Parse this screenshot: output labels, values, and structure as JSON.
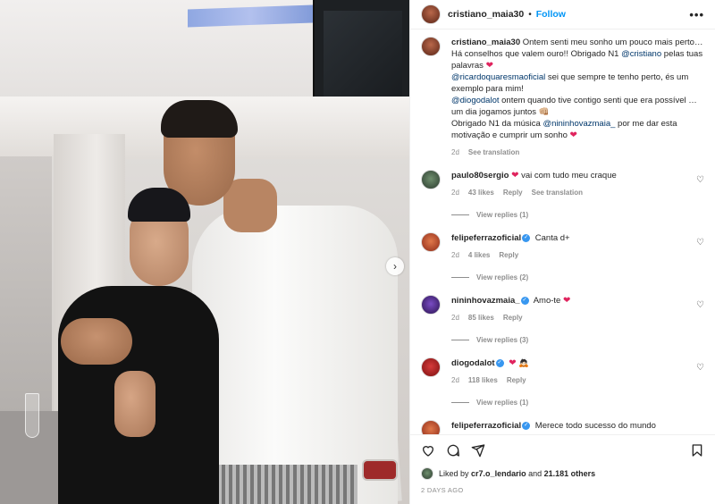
{
  "post": {
    "username": "cristiano_maia30",
    "follow_label": "Follow",
    "dot": "•",
    "more_label": "•••",
    "caption": {
      "username": "cristiano_maia30",
      "line1": "Ontem senti meu sonho um pouco mais perto…",
      "line2": "Há conselhos que valem ouro!! Obrigado N1",
      "mention1": "@cristiano",
      "line2b": "pelas tuas palavras",
      "mention2": "@ricardoquaresmaoficial",
      "line3": "sei que sempre te tenho perto, és um exemplo para mim!",
      "mention3": "@diogodalot",
      "line4": "ontem quando tive contigo senti que era possível … um dia jogamos juntos 👊🏼",
      "line5": "Obrigado N1 da música",
      "mention4": "@nininhovazmaia_",
      "line5b": "por me dar esta motivação e cumprir um sonho",
      "age": "2d",
      "see_translation": "See translation"
    },
    "heart": "❤",
    "comments": [
      {
        "username": "paulo80sergio",
        "text": "vai com tudo meu craque",
        "age": "2d",
        "likes": "43 likes",
        "reply": "Reply",
        "translation": "See translation",
        "replies": "View replies (1)",
        "verified": false
      },
      {
        "username": "felipeferrazoficial",
        "text": "Canta d+",
        "age": "2d",
        "likes": "4 likes",
        "reply": "Reply",
        "replies": "View replies (2)",
        "verified": true
      },
      {
        "username": "nininhovazmaia_",
        "text": "Amo-te",
        "age": "2d",
        "likes": "85 likes",
        "reply": "Reply",
        "replies": "View replies (3)",
        "verified": true
      },
      {
        "username": "diogodalot",
        "text": "",
        "age": "2d",
        "likes": "118 likes",
        "reply": "Reply",
        "replies": "View replies (1)",
        "verified": true
      },
      {
        "username": "felipeferrazoficial",
        "text": "Merece todo sucesso do mundo",
        "verified": true
      }
    ],
    "footer": {
      "liked_by_prefix": "Liked by",
      "liked_by_user": "cr7.o_lendario",
      "liked_by_and": "and",
      "liked_by_count": "21.181 others",
      "time_ago": "2 DAYS AGO"
    },
    "verified_mark": "✓",
    "next_arrow": "›"
  }
}
